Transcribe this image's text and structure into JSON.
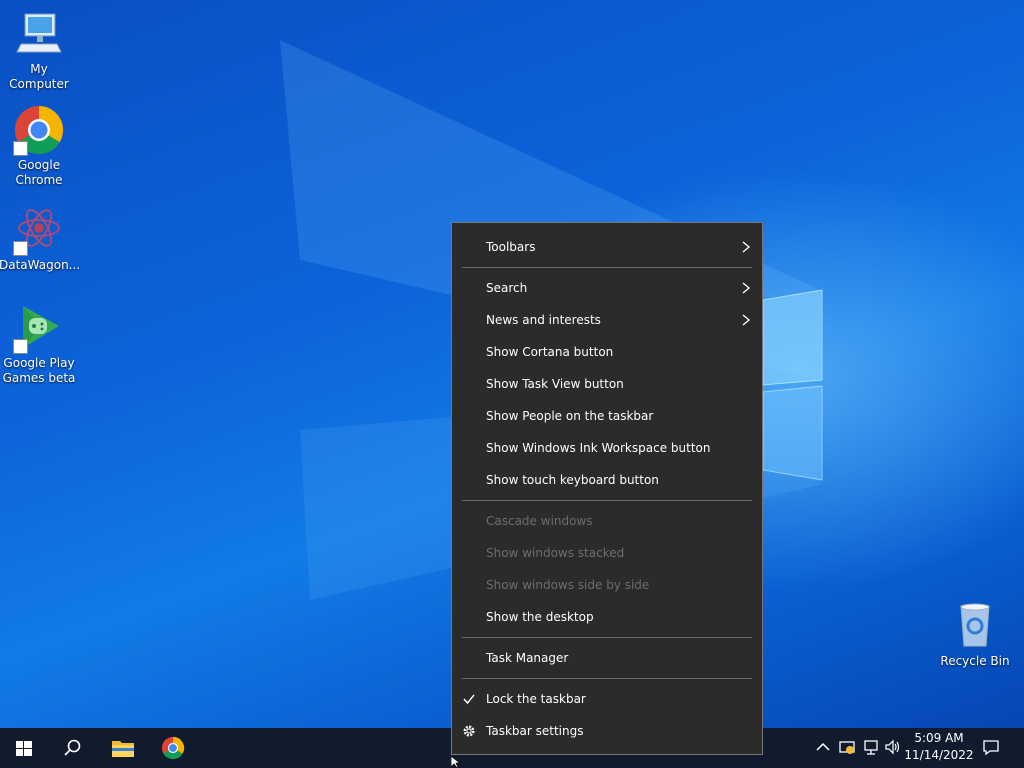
{
  "desktop": {
    "icons": [
      {
        "label": "My Computer",
        "icon": "computer-icon",
        "shortcut": false
      },
      {
        "label": "Google Chrome",
        "icon": "chrome-icon",
        "shortcut": true
      },
      {
        "label": "DataWagon...",
        "icon": "datawagon-icon",
        "shortcut": true
      },
      {
        "label": "Google Play Games beta",
        "icon": "play-games-icon",
        "shortcut": true
      },
      {
        "label": "Recycle Bin",
        "icon": "recycle-bin-icon",
        "shortcut": false
      }
    ]
  },
  "context_menu": {
    "items": [
      {
        "label": "Toolbars",
        "submenu": true,
        "enabled": true
      },
      {
        "label": "Search",
        "submenu": true,
        "enabled": true
      },
      {
        "label": "News and interests",
        "submenu": true,
        "enabled": true
      },
      {
        "label": "Show Cortana button",
        "enabled": true
      },
      {
        "label": "Show Task View button",
        "enabled": true
      },
      {
        "label": "Show People on the taskbar",
        "enabled": true
      },
      {
        "label": "Show Windows Ink Workspace button",
        "enabled": true
      },
      {
        "label": "Show touch keyboard button",
        "enabled": true
      },
      {
        "label": "Cascade windows",
        "enabled": false
      },
      {
        "label": "Show windows stacked",
        "enabled": false
      },
      {
        "label": "Show windows side by side",
        "enabled": false
      },
      {
        "label": "Show the desktop",
        "enabled": true
      },
      {
        "label": "Task Manager",
        "enabled": true
      },
      {
        "label": "Lock the taskbar",
        "enabled": true,
        "checked": true,
        "lead_icon": "checkmark-icon"
      },
      {
        "label": "Taskbar settings",
        "enabled": true,
        "lead_icon": "gear-icon"
      }
    ]
  },
  "taskbar": {
    "buttons": [
      {
        "name": "start-button",
        "icon": "windows-logo-icon"
      },
      {
        "name": "search-button",
        "icon": "search-icon"
      },
      {
        "name": "file-explorer-button",
        "icon": "folder-icon"
      },
      {
        "name": "chrome-taskbar-button",
        "icon": "chrome-icon"
      }
    ],
    "tray": {
      "icons": [
        "chevron-up-icon",
        "security-icon",
        "network-icon",
        "volume-icon"
      ],
      "time": "5:09 AM",
      "date": "11/14/2022",
      "notification_icon": "notification-icon"
    }
  },
  "colors": {
    "menu_bg": "#2b2b2b",
    "menu_disabled": "#6d6d6d",
    "taskbar_bg": "#101b2e",
    "desktop_blue": "#0c63d9"
  }
}
